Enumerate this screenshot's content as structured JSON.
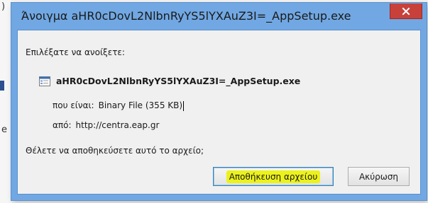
{
  "window": {
    "title": "Άνοιγμα aHR0cDovL2NlbnRyYS5lYXAuZ3I=_AppSetup.exe",
    "close_icon": "close-x-icon"
  },
  "dialog": {
    "prompt": "Επιλέξατε να ανοίξετε:",
    "file_icon": "exe-file-icon",
    "file_name": "aHR0cDovL2NlbnRyYS5lYXAuZ3I=_AppSetup.exe",
    "type_label": "που είναι:",
    "type_value": "Binary File (355 KB)",
    "from_label": "από:",
    "from_value": "http://centra.eap.gr",
    "question": "Θέλετε να αποθηκεύσετε αυτό το αρχείο;"
  },
  "buttons": {
    "save_label": "Αποθήκευση αρχείου",
    "cancel_label": "Ακύρωση"
  },
  "background": {
    "glyph_top": ")",
    "glyph_bottom": "e"
  },
  "colors": {
    "titlebar": "#71a8e3",
    "close_button": "#c7403a",
    "highlight": "#ecf21a"
  }
}
